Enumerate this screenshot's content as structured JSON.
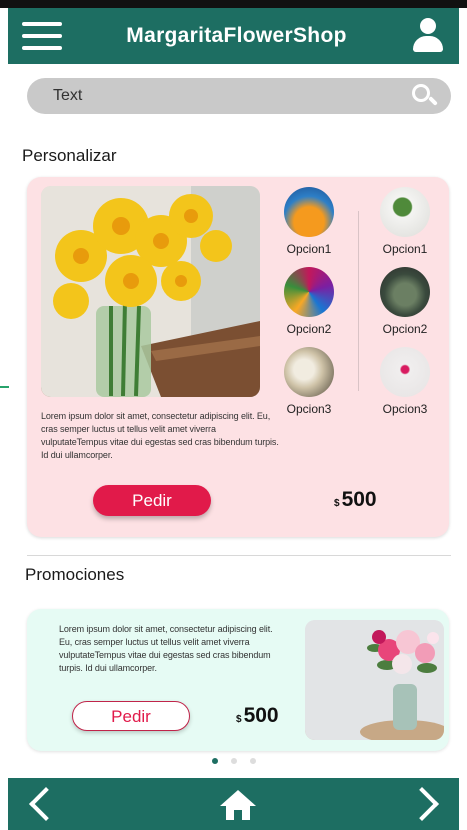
{
  "app": {
    "title": "MargaritaFlowerShop"
  },
  "search": {
    "placeholder": "Text"
  },
  "personalizar": {
    "title": "Personalizar",
    "options_left": [
      "Opcion1",
      "Opcion2",
      "Opcion3"
    ],
    "options_right": [
      "Opcion1",
      "Opcion2",
      "Opcion3"
    ],
    "description": "Lorem ipsum dolor sit amet, consectetur adipiscing elit. Eu, cras semper luctus ut tellus velit amet viverra vulputateTempus vitae dui egestas sed cras bibendum turpis. Id dui ullamcorper.",
    "button_label": "Pedir",
    "currency": "$",
    "price": "500"
  },
  "promociones": {
    "title": "Promociones",
    "description": "Lorem ipsum dolor sit amet, consectetur adipiscing elit. Eu, cras semper luctus ut tellus velit amet viverra vulputateTempus vitae dui egestas sed cras bibendum turpis. Id dui ullamcorper.",
    "button_label": "Pedir",
    "currency": "$",
    "price": "500"
  },
  "carousel": {
    "pages": 3,
    "active_index": 0
  },
  "icons": [
    "menu-icon",
    "user-icon",
    "search-icon",
    "back-icon",
    "home-icon",
    "forward-icon"
  ],
  "colors": {
    "primary": "#1d6e62",
    "accent": "#e11a4a",
    "pink_card": "#fde1e4",
    "mint_card": "#e6fbf4"
  }
}
